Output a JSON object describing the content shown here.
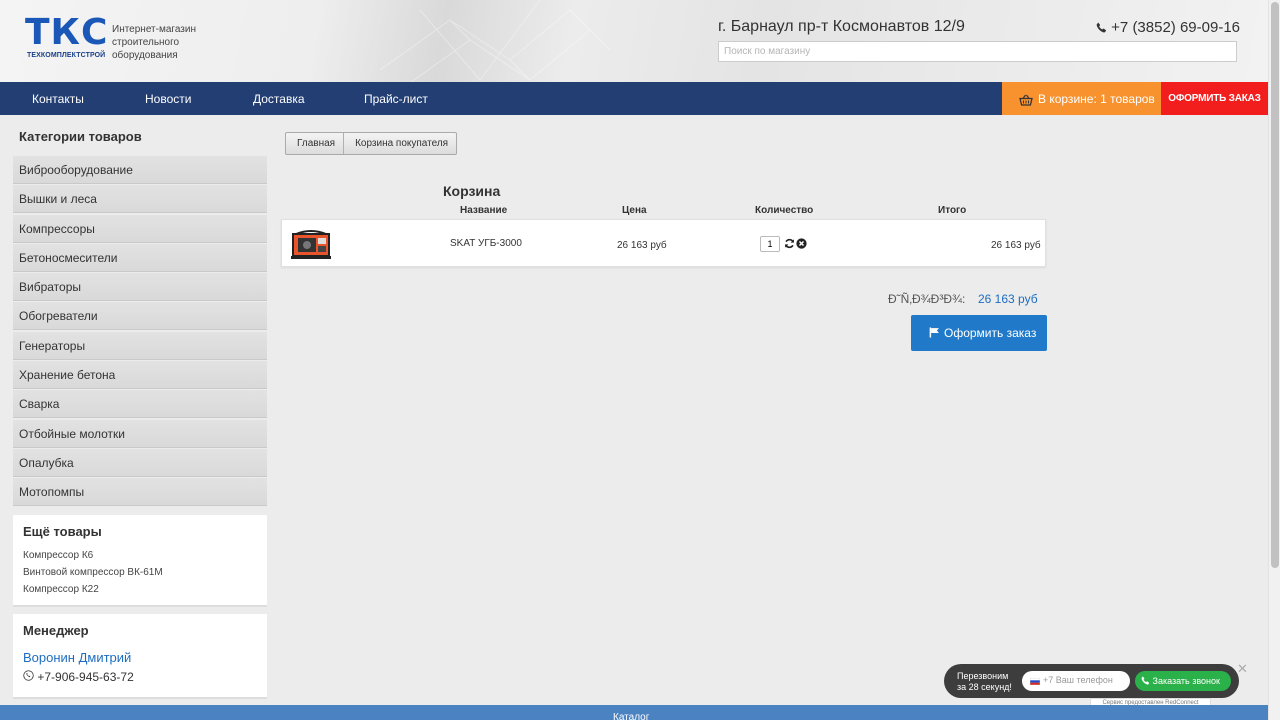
{
  "header": {
    "logo_big": "ТКС",
    "logo_small": "ТЕХКОМПЛЕКТСТРОЙ",
    "tagline": [
      "Интернет-магазин",
      "строительного",
      "оборудования"
    ],
    "address": "г. Барнаул пр-т Космонавтов 12/9",
    "phone": "+7 (3852) 69-09-16",
    "search_placeholder": "Поиск по магазину"
  },
  "nav": {
    "items": [
      "Контакты",
      "Новости",
      "Доставка",
      "Прайс-лист"
    ],
    "cart_label": "В корзине: 1 товаров",
    "order_label": "ОФОРМИТЬ ЗАКАЗ"
  },
  "sidebar": {
    "categories_title": "Категории товаров",
    "categories": [
      "Виброоборудование",
      "Вышки и леса",
      "Компрессоры",
      "Бетоносмесители",
      "Вибраторы",
      "Обогреватели",
      "Генераторы",
      "Хранение бетона",
      "Сварка",
      "Отбойные молотки",
      "Опалубка",
      "Мотопомпы"
    ],
    "more_title": "Ещё товары",
    "more_items": [
      "Компрессор К6",
      "Винтовой компрессор ВК-61М",
      "Компрессор К22"
    ],
    "manager_title": "Менеджер",
    "manager_name": "Воронин Дмитрий",
    "manager_phone": "+7-906-945-63-72"
  },
  "breadcrumb": [
    "Главная",
    "Корзина покупателя"
  ],
  "cart": {
    "title": "Корзина",
    "columns": [
      "Название",
      "Цена",
      "Количество",
      "Итого"
    ],
    "rows": [
      {
        "name": "SKAT УГБ-3000",
        "price": "26 163 руб",
        "qty": "1",
        "total": "26 163 руб"
      }
    ],
    "total_label": "Ð˜Ñ‚Ð¾Ð³Ð¾:",
    "total_value": "26 163 руб",
    "checkout_label": "Оформить заказ"
  },
  "callback": {
    "text_line1": "Перезвоним",
    "text_line2": "за 28 секунд!",
    "phone_placeholder": "+7 Ваш телефон",
    "button_label": "Заказать звонок",
    "credit": "Сервис предоставлен RedConnect"
  },
  "footer": {
    "label": "Каталог"
  },
  "colors": {
    "nav_bg": "#223e73",
    "cart_orange": "#f7922f",
    "order_red": "#f21d1d",
    "accent_blue": "#2079c9",
    "callback_green": "#2bb14a"
  }
}
